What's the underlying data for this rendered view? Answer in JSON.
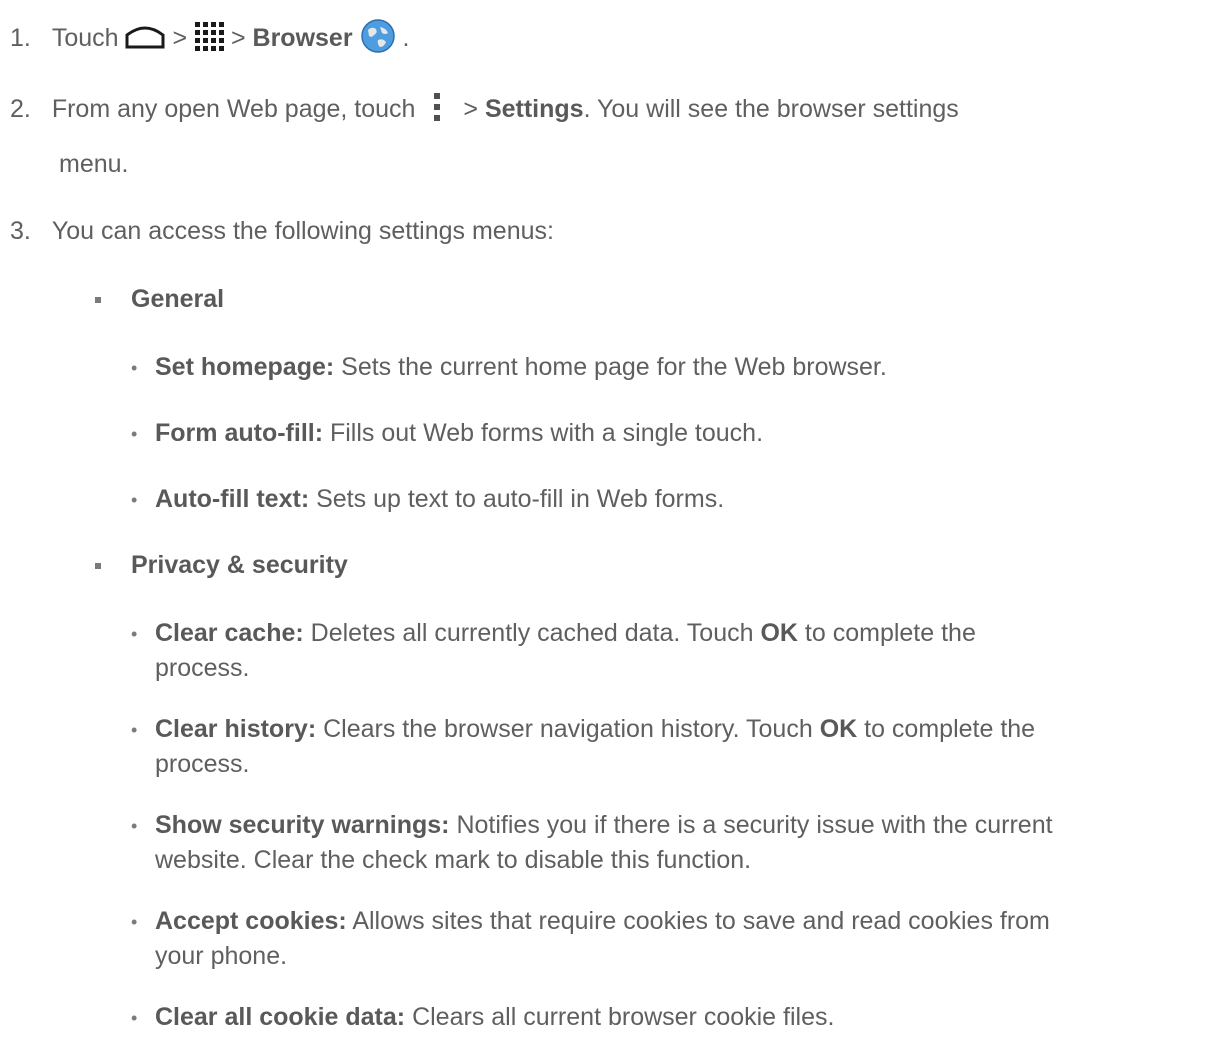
{
  "steps": [
    {
      "number": "1.",
      "touch": "Touch",
      "sep1": ">",
      "sep2": ">",
      "browser": "Browser",
      "end": "."
    },
    {
      "number": "2.",
      "before": "From any open Web page, touch",
      "sep": ">",
      "settings": "Settings",
      "after": ". You will see the browser settings",
      "wrap": "menu."
    },
    {
      "number": "3.",
      "text": "You can access the following settings menus:"
    }
  ],
  "sections": [
    {
      "heading": "General",
      "items": [
        {
          "term": "Set homepage:",
          "desc": "Sets the current home page for the Web browser."
        },
        {
          "term": "Form auto-fill:",
          "desc": "Fills out Web forms with a single touch."
        },
        {
          "term": "Auto-fill text:",
          "desc": "Sets up text to auto-fill in Web forms."
        }
      ]
    },
    {
      "heading": "Privacy & security",
      "items": [
        {
          "term": "Clear cache:",
          "desc": "Deletes all currently cached data. Touch",
          "ok": "OK",
          "desc2": "to complete the",
          "wrap": "process."
        },
        {
          "term": "Clear history:",
          "desc": "Clears the browser navigation history. Touch",
          "ok": "OK",
          "desc2": "to complete the",
          "wrap": "process."
        },
        {
          "term": "Show security warnings:",
          "desc": "Notifies you if there is a security issue with the current",
          "wrap": "website. Clear the check mark to disable this function."
        },
        {
          "term": "Accept cookies:",
          "desc": "Allows sites that require cookies to save and read cookies from",
          "wrap": "your phone."
        },
        {
          "term": "Clear all cookie data:",
          "desc": "Clears all current browser cookie files."
        }
      ]
    }
  ],
  "icons": {
    "home": "home-icon",
    "apps": "apps-grid-icon",
    "browser": "globe-icon",
    "menu": "menu-dots-icon"
  },
  "colors": {
    "text": "#5f5f5f",
    "bold": "#595959",
    "bullet": "#7a7a7a"
  },
  "bullets": {
    "square": "▪",
    "dot": "•"
  }
}
